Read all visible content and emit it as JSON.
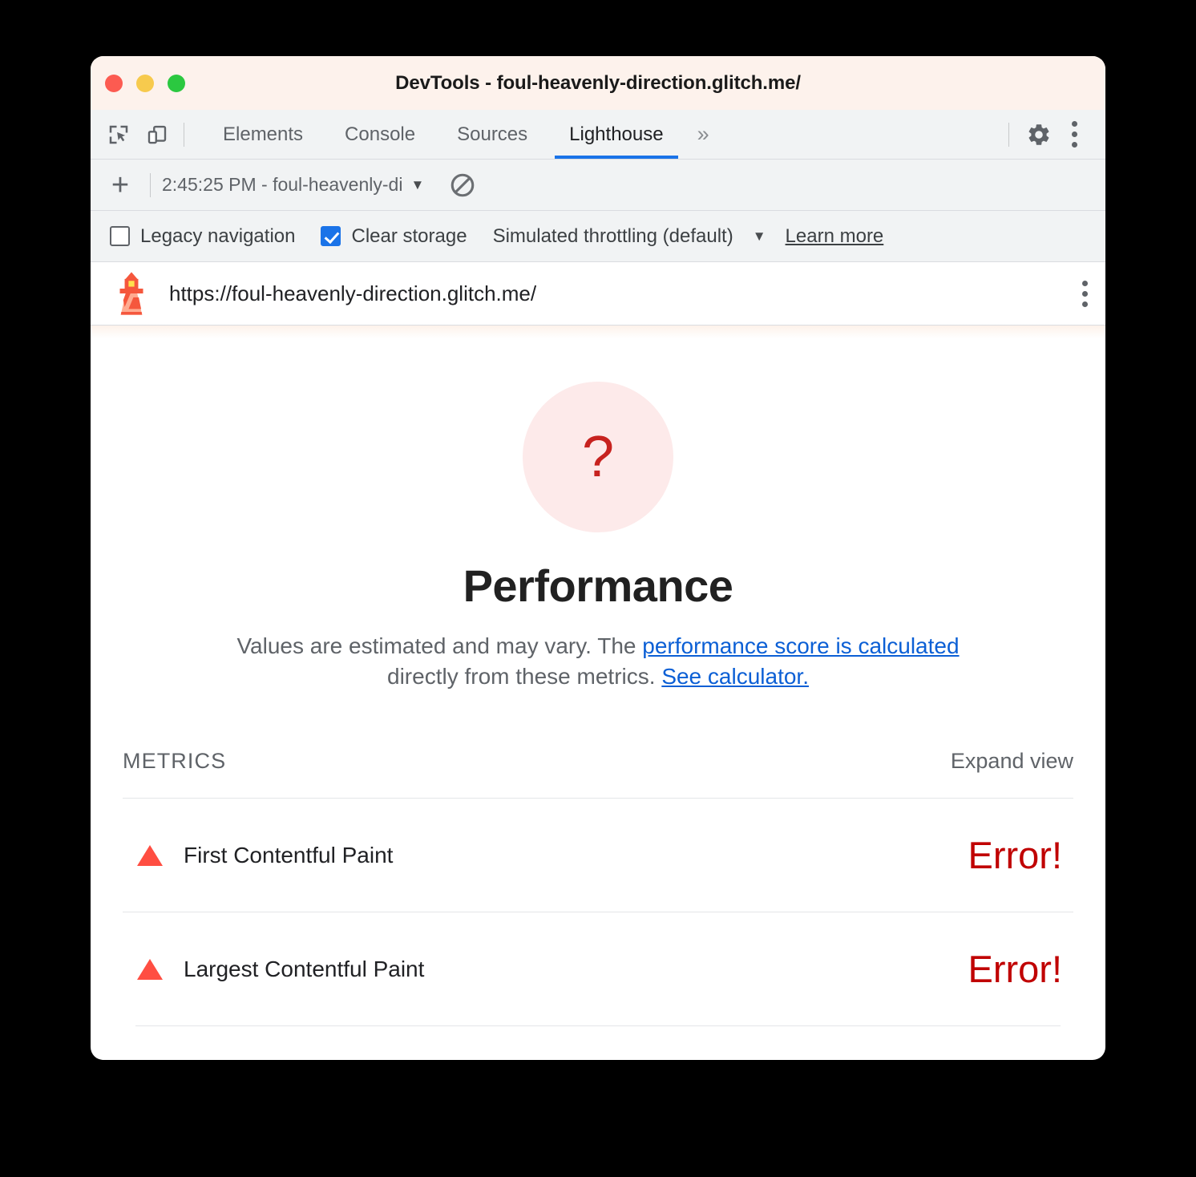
{
  "window": {
    "title": "DevTools - foul-heavenly-direction.glitch.me/",
    "traffic_lights": [
      "close",
      "minimize",
      "maximize"
    ]
  },
  "tabstrip": {
    "inspect_icon": "inspect-element-icon",
    "device_icon": "device-toolbar-icon",
    "tabs": [
      {
        "label": "Elements",
        "active": false
      },
      {
        "label": "Console",
        "active": false
      },
      {
        "label": "Sources",
        "active": false
      },
      {
        "label": "Lighthouse",
        "active": true
      }
    ],
    "more_tabs": "»",
    "settings_icon": "gear-icon",
    "main_menu_icon": "more-vertical-icon",
    "active_tab_accent": "#1a73e8"
  },
  "run_toolbar": {
    "add_label": "+",
    "run_selected": "2:45:25 PM - foul-heavenly-di",
    "dropdown_caret": "▼",
    "clear_icon": "clear-all-icon"
  },
  "options": {
    "legacy_navigation": {
      "label": "Legacy navigation",
      "checked": false
    },
    "clear_storage": {
      "label": "Clear storage",
      "checked": true
    },
    "throttling": {
      "label": "Simulated throttling (default)",
      "caret": "▼"
    },
    "learn_more": "Learn more"
  },
  "url_bar": {
    "logo_icon": "lighthouse-icon",
    "url": "https://foul-heavenly-direction.glitch.me/",
    "menu_icon": "more-vertical-icon"
  },
  "report": {
    "gauge": {
      "score_glyph": "?",
      "fill_color": "#fdeaea",
      "glyph_color": "#c7221f"
    },
    "category_title": "Performance",
    "description": {
      "part1": "Values are estimated and may vary. The ",
      "link1": "performance score is calculated",
      "part2": " directly from these metrics. ",
      "link2": "See calculator."
    },
    "metrics_header": {
      "title": "METRICS",
      "expand_view": "Expand view"
    },
    "metrics": [
      {
        "icon": "error-triangle-icon",
        "name": "First Contentful Paint",
        "value": "Error!",
        "value_color": "#c00000",
        "icon_color": "#ff4e42"
      },
      {
        "icon": "error-triangle-icon",
        "name": "Largest Contentful Paint",
        "value": "Error!",
        "value_color": "#c00000",
        "icon_color": "#ff4e42"
      }
    ]
  }
}
